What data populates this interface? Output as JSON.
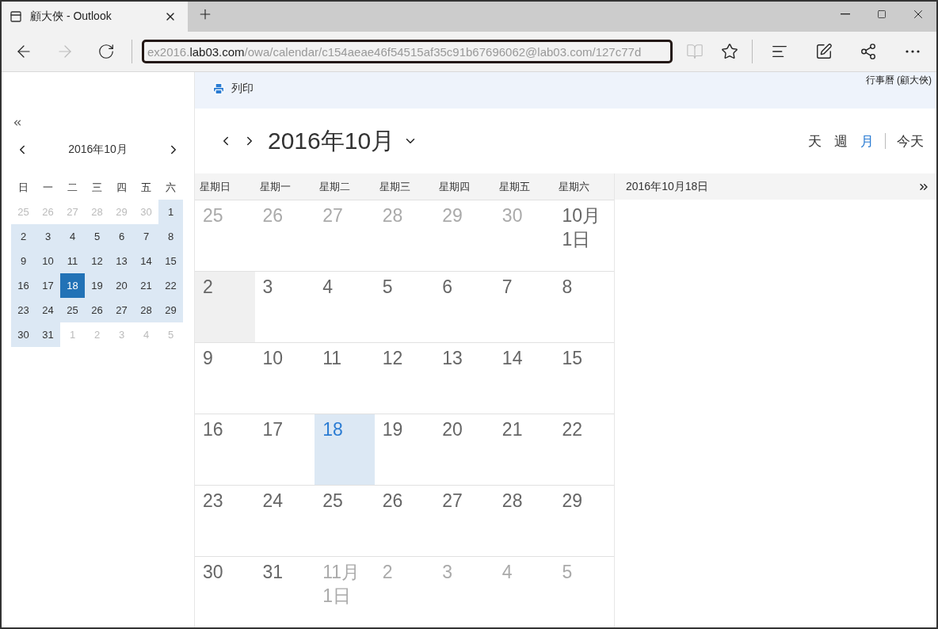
{
  "browser": {
    "tab_title": "顧大俠 - Outlook",
    "url_parts": [
      {
        "text": "ex2016.",
        "strong": false
      },
      {
        "text": "lab03.com",
        "strong": true
      },
      {
        "text": "/owa/calendar/c154aeae46f54515af35c91b67696062@lab03.com/127c77d",
        "strong": false
      }
    ]
  },
  "toolbar": {
    "print_label": "列印",
    "calendar_name": "行事曆 (顧大俠)"
  },
  "mini_calendar": {
    "title": "2016年10月",
    "weekdays": [
      "日",
      "一",
      "二",
      "三",
      "四",
      "五",
      "六"
    ],
    "days": [
      {
        "label": "25",
        "muted": true,
        "selected": false
      },
      {
        "label": "26",
        "muted": true,
        "selected": false
      },
      {
        "label": "27",
        "muted": true,
        "selected": false
      },
      {
        "label": "28",
        "muted": true,
        "selected": false
      },
      {
        "label": "29",
        "muted": true,
        "selected": false
      },
      {
        "label": "30",
        "muted": true,
        "selected": false
      },
      {
        "label": "1",
        "muted": false,
        "selected": false
      },
      {
        "label": "2",
        "muted": false,
        "selected": false
      },
      {
        "label": "3",
        "muted": false,
        "selected": false
      },
      {
        "label": "4",
        "muted": false,
        "selected": false
      },
      {
        "label": "5",
        "muted": false,
        "selected": false
      },
      {
        "label": "6",
        "muted": false,
        "selected": false
      },
      {
        "label": "7",
        "muted": false,
        "selected": false
      },
      {
        "label": "8",
        "muted": false,
        "selected": false
      },
      {
        "label": "9",
        "muted": false,
        "selected": false
      },
      {
        "label": "10",
        "muted": false,
        "selected": false
      },
      {
        "label": "11",
        "muted": false,
        "selected": false
      },
      {
        "label": "12",
        "muted": false,
        "selected": false
      },
      {
        "label": "13",
        "muted": false,
        "selected": false
      },
      {
        "label": "14",
        "muted": false,
        "selected": false
      },
      {
        "label": "15",
        "muted": false,
        "selected": false
      },
      {
        "label": "16",
        "muted": false,
        "selected": false
      },
      {
        "label": "17",
        "muted": false,
        "selected": false
      },
      {
        "label": "18",
        "muted": false,
        "selected": true
      },
      {
        "label": "19",
        "muted": false,
        "selected": false
      },
      {
        "label": "20",
        "muted": false,
        "selected": false
      },
      {
        "label": "21",
        "muted": false,
        "selected": false
      },
      {
        "label": "22",
        "muted": false,
        "selected": false
      },
      {
        "label": "23",
        "muted": false,
        "selected": false
      },
      {
        "label": "24",
        "muted": false,
        "selected": false
      },
      {
        "label": "25",
        "muted": false,
        "selected": false
      },
      {
        "label": "26",
        "muted": false,
        "selected": false
      },
      {
        "label": "27",
        "muted": false,
        "selected": false
      },
      {
        "label": "28",
        "muted": false,
        "selected": false
      },
      {
        "label": "29",
        "muted": false,
        "selected": false
      },
      {
        "label": "30",
        "muted": false,
        "selected": false
      },
      {
        "label": "31",
        "muted": false,
        "selected": false
      },
      {
        "label": "1",
        "muted": true,
        "selected": false
      },
      {
        "label": "2",
        "muted": true,
        "selected": false
      },
      {
        "label": "3",
        "muted": true,
        "selected": false
      },
      {
        "label": "4",
        "muted": true,
        "selected": false
      },
      {
        "label": "5",
        "muted": true,
        "selected": false
      }
    ]
  },
  "month_view": {
    "title": "2016年10月",
    "views": [
      {
        "label": "天",
        "selected": false
      },
      {
        "label": "週",
        "selected": false
      },
      {
        "label": "月",
        "selected": true
      }
    ],
    "today_label": "今天",
    "weekdays": [
      "星期日",
      "星期一",
      "星期二",
      "星期三",
      "星期四",
      "星期五",
      "星期六"
    ],
    "days": [
      {
        "label": "25",
        "muted": true,
        "selected": false,
        "hovered": false
      },
      {
        "label": "26",
        "muted": true,
        "selected": false,
        "hovered": false
      },
      {
        "label": "27",
        "muted": true,
        "selected": false,
        "hovered": false
      },
      {
        "label": "28",
        "muted": true,
        "selected": false,
        "hovered": false
      },
      {
        "label": "29",
        "muted": true,
        "selected": false,
        "hovered": false
      },
      {
        "label": "30",
        "muted": true,
        "selected": false,
        "hovered": false
      },
      {
        "label": "10月1日",
        "muted": false,
        "selected": false,
        "hovered": false
      },
      {
        "label": "2",
        "muted": false,
        "selected": false,
        "hovered": true
      },
      {
        "label": "3",
        "muted": false,
        "selected": false,
        "hovered": false
      },
      {
        "label": "4",
        "muted": false,
        "selected": false,
        "hovered": false
      },
      {
        "label": "5",
        "muted": false,
        "selected": false,
        "hovered": false
      },
      {
        "label": "6",
        "muted": false,
        "selected": false,
        "hovered": false
      },
      {
        "label": "7",
        "muted": false,
        "selected": false,
        "hovered": false
      },
      {
        "label": "8",
        "muted": false,
        "selected": false,
        "hovered": false
      },
      {
        "label": "9",
        "muted": false,
        "selected": false,
        "hovered": false
      },
      {
        "label": "10",
        "muted": false,
        "selected": false,
        "hovered": false
      },
      {
        "label": "11",
        "muted": false,
        "selected": false,
        "hovered": false
      },
      {
        "label": "12",
        "muted": false,
        "selected": false,
        "hovered": false
      },
      {
        "label": "13",
        "muted": false,
        "selected": false,
        "hovered": false
      },
      {
        "label": "14",
        "muted": false,
        "selected": false,
        "hovered": false
      },
      {
        "label": "15",
        "muted": false,
        "selected": false,
        "hovered": false
      },
      {
        "label": "16",
        "muted": false,
        "selected": false,
        "hovered": false
      },
      {
        "label": "17",
        "muted": false,
        "selected": false,
        "hovered": false
      },
      {
        "label": "18",
        "muted": false,
        "selected": true,
        "hovered": false
      },
      {
        "label": "19",
        "muted": false,
        "selected": false,
        "hovered": false
      },
      {
        "label": "20",
        "muted": false,
        "selected": false,
        "hovered": false
      },
      {
        "label": "21",
        "muted": false,
        "selected": false,
        "hovered": false
      },
      {
        "label": "22",
        "muted": false,
        "selected": false,
        "hovered": false
      },
      {
        "label": "23",
        "muted": false,
        "selected": false,
        "hovered": false
      },
      {
        "label": "24",
        "muted": false,
        "selected": false,
        "hovered": false
      },
      {
        "label": "25",
        "muted": false,
        "selected": false,
        "hovered": false
      },
      {
        "label": "26",
        "muted": false,
        "selected": false,
        "hovered": false
      },
      {
        "label": "27",
        "muted": false,
        "selected": false,
        "hovered": false
      },
      {
        "label": "28",
        "muted": false,
        "selected": false,
        "hovered": false
      },
      {
        "label": "29",
        "muted": false,
        "selected": false,
        "hovered": false
      },
      {
        "label": "30",
        "muted": false,
        "selected": false,
        "hovered": false
      },
      {
        "label": "31",
        "muted": false,
        "selected": false,
        "hovered": false
      },
      {
        "label": "11月1日",
        "muted": true,
        "selected": false,
        "hovered": false
      },
      {
        "label": "2",
        "muted": true,
        "selected": false,
        "hovered": false
      },
      {
        "label": "3",
        "muted": true,
        "selected": false,
        "hovered": false
      },
      {
        "label": "4",
        "muted": true,
        "selected": false,
        "hovered": false
      },
      {
        "label": "5",
        "muted": true,
        "selected": false,
        "hovered": false
      }
    ]
  },
  "detail_pane": {
    "date": "2016年10月18日"
  }
}
